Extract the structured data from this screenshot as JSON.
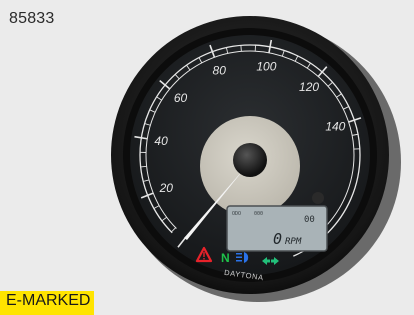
{
  "product_code": "85833",
  "badge": "E-MARKED",
  "gauge": {
    "labels": [
      "20",
      "40",
      "60",
      "80",
      "100",
      "120",
      "140"
    ],
    "brand": "DAYTONA",
    "lcd": {
      "odo_label": "ODO",
      "odo_value": "000",
      "value": "0",
      "unit": "RPM",
      "gear": "00"
    },
    "indicators": {
      "warning": "warning-triangle",
      "neutral": "N",
      "high_beam": "high-beam",
      "turn": "turn-signal-arrows"
    },
    "needle_value": 0
  },
  "colors": {
    "background": "#ebebeb",
    "badge": "#ffe400",
    "needle": "#f4f4f4",
    "warning": "#e8222a",
    "neutral": "#1ec24a",
    "high_beam": "#2a72e8",
    "turn": "#22c07a",
    "lcd": "#a9b3b7"
  }
}
